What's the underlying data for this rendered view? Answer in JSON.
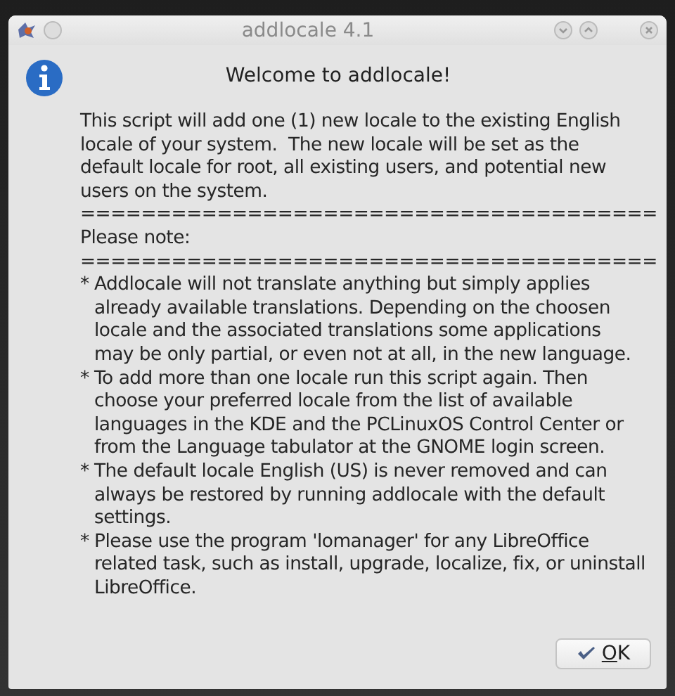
{
  "window": {
    "title": "addlocale 4.1"
  },
  "heading": "Welcome to addlocale!",
  "body": [
    {
      "kind": "paragraph",
      "lines": [
        "This script will add one (1) new locale to the existing English",
        "locale of your system.  The new locale will be set as the",
        "default locale for root, all existing users, and potential new",
        "users on the system."
      ]
    },
    {
      "kind": "rule",
      "lines": [
        "======================================"
      ]
    },
    {
      "kind": "paragraph",
      "lines": [
        "Please note:"
      ]
    },
    {
      "kind": "rule",
      "lines": [
        "======================================"
      ]
    },
    {
      "kind": "bullet",
      "marker": "*",
      "lines": [
        "Addlocale will not translate anything but simply applies",
        "already available translations. Depending on the choosen",
        "locale and the associated translations some applications",
        "may be only partial, or even not at all, in the new language."
      ]
    },
    {
      "kind": "bullet",
      "marker": "*",
      "lines": [
        "To add more than one locale run this script again. Then",
        "choose your preferred locale from the list of available",
        "languages in the KDE and the PCLinuxOS Control Center or",
        "from the Language tabulator at the GNOME login screen."
      ]
    },
    {
      "kind": "bullet",
      "marker": "*",
      "lines": [
        "The default locale English (US) is never removed and can",
        "always be restored by running addlocale with the default",
        "settings."
      ]
    },
    {
      "kind": "bullet",
      "marker": "*",
      "lines": [
        "Please use the program 'lomanager' for any LibreOffice",
        "related task, such as install, upgrade, localize, fix, or uninstall",
        "LibreOffice."
      ]
    }
  ],
  "ok_button": {
    "mnemonic": "O",
    "rest": "K"
  }
}
